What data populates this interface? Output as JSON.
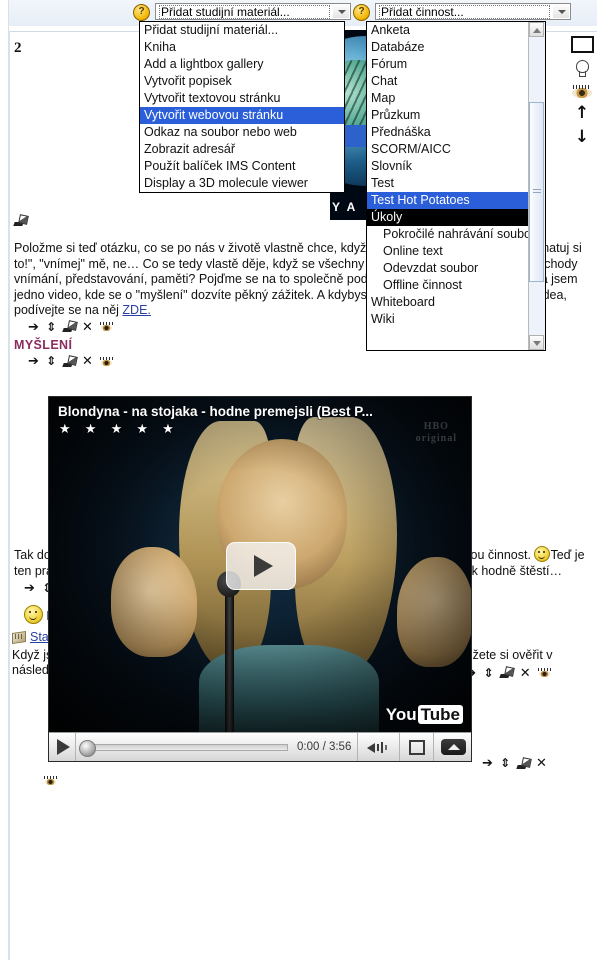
{
  "section": {
    "number": "2"
  },
  "toolbar": {
    "help_icon_label": "?",
    "resource_select": {
      "name": "Přidat studijní materiál",
      "value": "Přidat studijní materiál...",
      "options": [
        "Přidat studijní materiál...",
        "Kniha",
        "Add a lightbox gallery",
        "Vytvořit popisek",
        "Vytvořit textovou stránku",
        "Vytvořit webovou stránku",
        "Odkaz na soubor nebo web",
        "Zobrazit adresář",
        "Použít balíček IMS Content",
        "Display a 3D molecule viewer"
      ],
      "highlighted": "Vytvořit webovou stránku"
    },
    "activity_select": {
      "name": "Přidat činnost",
      "value": "Přidat činnost...",
      "options": [
        {
          "label": "Anketa",
          "indent": false,
          "state": "normal"
        },
        {
          "label": "Databáze",
          "indent": false,
          "state": "normal"
        },
        {
          "label": "Fórum",
          "indent": false,
          "state": "normal"
        },
        {
          "label": "Chat",
          "indent": false,
          "state": "normal"
        },
        {
          "label": "Map",
          "indent": false,
          "state": "normal"
        },
        {
          "label": "Průzkum",
          "indent": false,
          "state": "normal"
        },
        {
          "label": "Přednáška",
          "indent": false,
          "state": "normal"
        },
        {
          "label": "SCORM/AICC",
          "indent": false,
          "state": "normal"
        },
        {
          "label": "Slovník",
          "indent": false,
          "state": "normal"
        },
        {
          "label": "Test",
          "indent": false,
          "state": "normal"
        },
        {
          "label": "Test Hot Potatoes",
          "indent": false,
          "state": "hover"
        },
        {
          "label": "Úkoly",
          "indent": false,
          "state": "selected"
        },
        {
          "label": "Pokročilé nahrávání souborů",
          "indent": true,
          "state": "normal"
        },
        {
          "label": "Online text",
          "indent": true,
          "state": "normal"
        },
        {
          "label": "Odevzdat soubor",
          "indent": true,
          "state": "normal"
        },
        {
          "label": "Offline činnost",
          "indent": true,
          "state": "normal"
        },
        {
          "label": "Whiteboard",
          "indent": false,
          "state": "normal"
        },
        {
          "label": "Wiki",
          "indent": false,
          "state": "normal"
        }
      ]
    }
  },
  "banner": {
    "text": "Y A"
  },
  "rail": {
    "items": [
      {
        "icon": "highlight-section-icon",
        "label": ""
      },
      {
        "icon": "lightbulb-icon",
        "label": ""
      },
      {
        "icon": "eye-visible-icon",
        "label": ""
      },
      {
        "icon": "move-up-icon",
        "label": "↑"
      },
      {
        "icon": "move-down-icon",
        "label": "↓"
      }
    ]
  },
  "content": {
    "paragraph1": "Položme si teď otázku, co se po nás v životě vlastně chce, když nám někdo říká: \"Mysli\", \"zapamatuj si to!\", \"vnímej\" mě, ne… Co se tedy vlastě děje, když se všechny tyto činnosti snažíme vyvíjet, pochody vnímání, představování, paměti? Pojďme se na to společně podívat a myslím to doslovně. Našla jsem jedno video, kde se o \"myšlení\" dozvíte pěkný zážitek. A kdybyste měli problém se spuštěním videa, podívejte se na něj ",
    "paragraph1_link": "ZDE.",
    "heading": "MYŠLENÍ",
    "paragraph2_a": "Tak doufám, že se povedlo a že vás vidoukázka naladila na vaši vlastní myšlenkovou činnost.",
    "paragraph2_b": "Teď je ten pravý čas, abyste trochu potrápili svůj mozek…Čeká na vás Startovací úkol. Tak hodně štěstí…",
    "activity_label": "Bodovaná aktivita",
    "resource_link": "Startovací úkol 2",
    "paragraph3": "Když jste si tak trochu sami pojmenovali jednotlivé fáze myšlenkového procesu, můžete si ověřit v následujícím textu, zda se shoduje vaše pojetí s tím, které vám v textu nabízím."
  },
  "video": {
    "title": "Blondyna - na stojaka - hodne premejsli (Best P...",
    "stars": "★ ★ ★ ★ ★",
    "watermark": "HBO\noriginal",
    "time": "0:00 / 3:56",
    "brand_you": "You",
    "brand_tube": "Tube"
  },
  "edit_icons": {
    "move_right": "➔",
    "move_updown": "⇕",
    "edit": "edit-pencil-icon",
    "delete": "✕",
    "hide": "eye-icon",
    "lock": "lock-icon"
  }
}
